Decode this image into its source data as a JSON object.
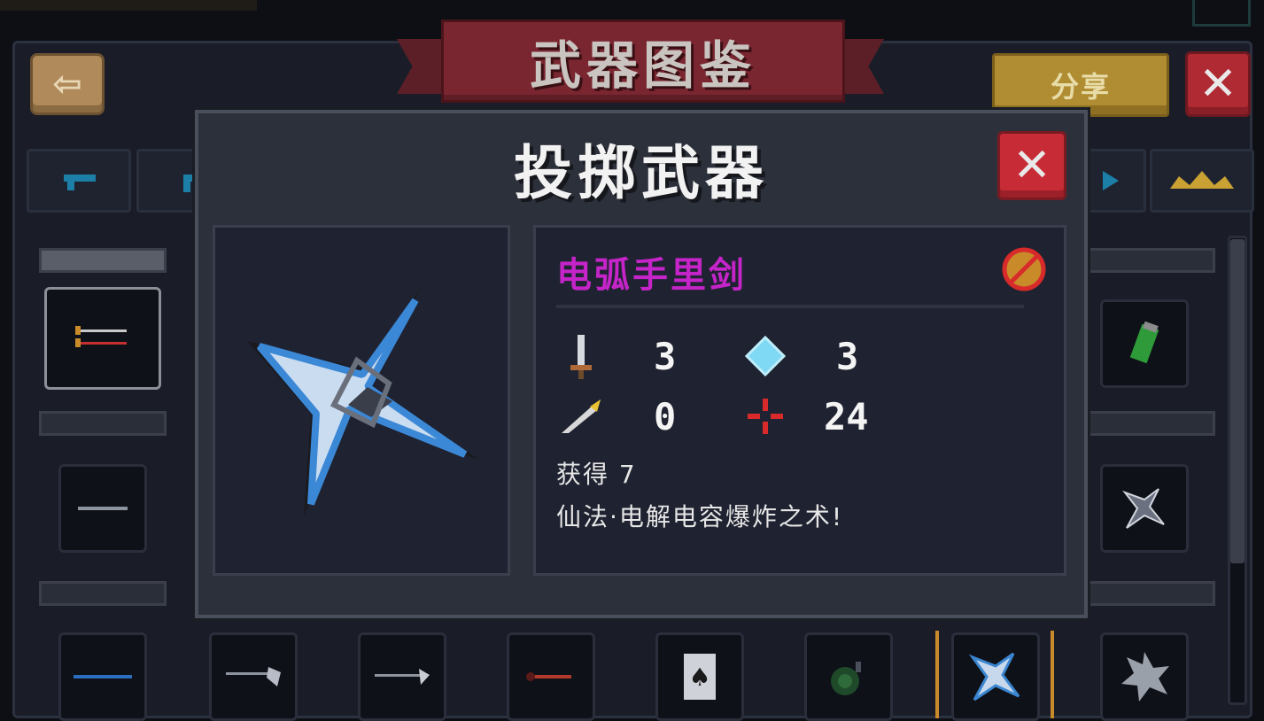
{
  "header": {
    "banner_title": "武器图鉴",
    "share_label": "分享",
    "back_icon": "back-arrow-icon",
    "close_icon": "close-icon"
  },
  "category_tabs": [
    {
      "icon": "pistol-icon",
      "color": "#1c7fa8"
    },
    {
      "icon": "rifle-icon",
      "color": "#1c7fa8"
    },
    {
      "icon": "bow-icon",
      "color": "#1c7fa8"
    },
    {
      "icon": "crown-icon",
      "color": "#c9a233"
    }
  ],
  "modal": {
    "title": "投掷武器",
    "weapon": {
      "name": "电弧手里剑",
      "name_color": "#c424c8",
      "icon": "shuriken-icon",
      "no_sale_icon": "no-sale-icon"
    },
    "stats": [
      {
        "icon": "sword-icon",
        "label": "damage",
        "value": "3"
      },
      {
        "icon": "crystal-icon",
        "label": "energy",
        "value": "3"
      },
      {
        "icon": "feather-icon",
        "label": "crit",
        "value": "0"
      },
      {
        "icon": "crosshair-icon",
        "label": "spread",
        "value": "24"
      }
    ],
    "obtain_text": "获得 7",
    "description": "仙法·电解电容爆炸之术!"
  },
  "side_slots_left": [
    {
      "icon": "twin-blades-icon"
    },
    {
      "icon": "knife-icon"
    }
  ],
  "side_slots_right": [
    {
      "icon": "green-scroll-icon"
    },
    {
      "icon": "shuriken-icon"
    }
  ],
  "bottom_slots": [
    {
      "icon": "blue-spear-icon"
    },
    {
      "icon": "axe-icon"
    },
    {
      "icon": "halberd-icon"
    },
    {
      "icon": "red-dagger-icon"
    },
    {
      "icon": "spade-card-icon"
    },
    {
      "icon": "bomb-icon"
    },
    {
      "icon": "shuriken-icon",
      "selected": true
    },
    {
      "icon": "sawblade-icon"
    }
  ]
}
